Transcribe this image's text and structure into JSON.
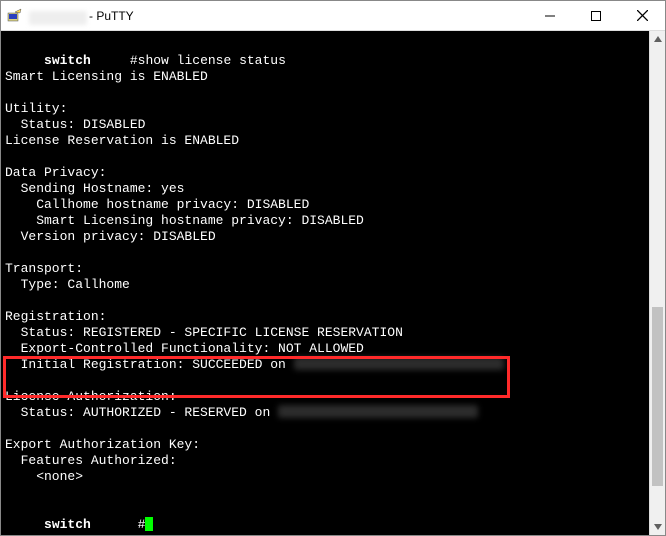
{
  "window": {
    "app_name": "PuTTY",
    "title_prefix_redacted": true
  },
  "terminal": {
    "prompt_host": "switch",
    "prompt_symbol": "#",
    "command": "show license status",
    "lines": {
      "smart_licensing": "Smart Licensing is ENABLED",
      "utility_header": "Utility:",
      "utility_status": "  Status: DISABLED",
      "license_reservation": "License Reservation is ENABLED",
      "data_privacy_header": "Data Privacy:",
      "sending_hostname": "  Sending Hostname: yes",
      "callhome_privacy": "    Callhome hostname privacy: DISABLED",
      "smart_privacy": "    Smart Licensing hostname privacy: DISABLED",
      "version_privacy": "  Version privacy: DISABLED",
      "transport_header": "Transport:",
      "transport_type": "  Type: Callhome",
      "registration_header": "Registration:",
      "registration_status": "  Status: REGISTERED - SPECIFIC LICENSE RESERVATION",
      "export_controlled": "  Export-Controlled Functionality: NOT ALLOWED",
      "initial_registration": "  Initial Registration: SUCCEEDED on ",
      "license_auth_header": "License Authorization:",
      "license_auth_status": "  Status: AUTHORIZED - RESERVED on ",
      "export_key_header": "Export Authorization Key:",
      "features_authorized": "  Features Authorized:",
      "features_none": "    <none>"
    }
  }
}
